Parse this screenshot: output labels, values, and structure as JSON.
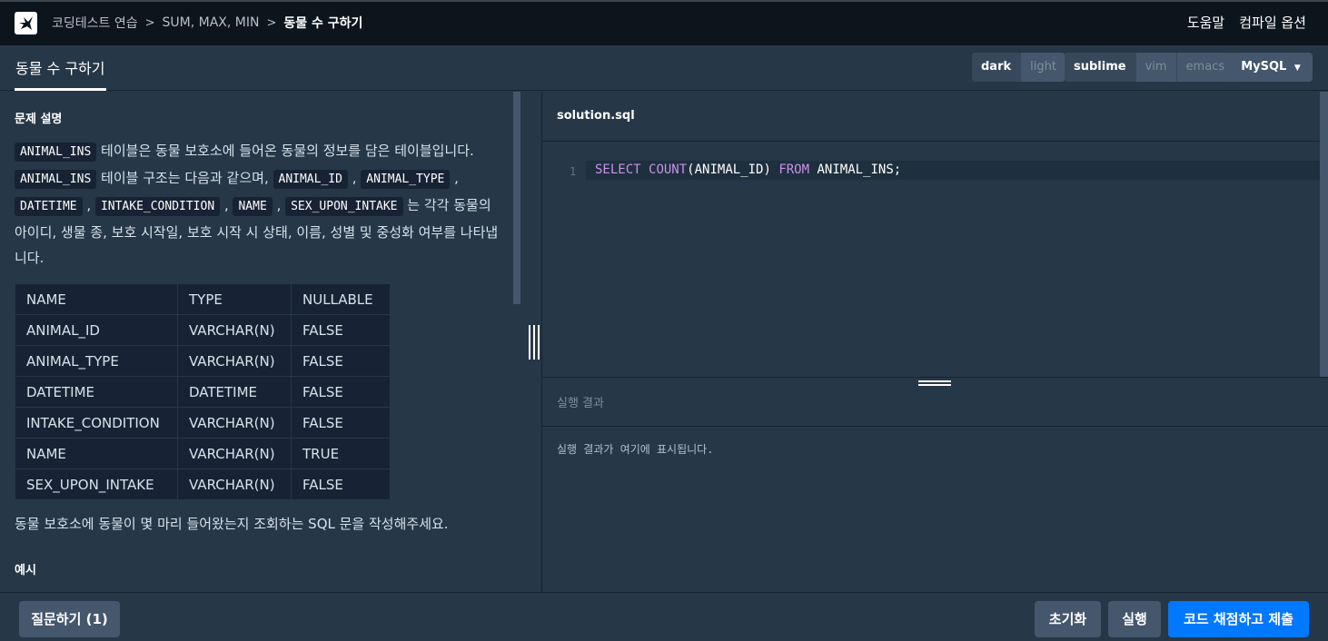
{
  "breadcrumb": {
    "items": [
      "코딩테스트 연습",
      "SUM, MAX, MIN"
    ],
    "current": "동물 수 구하기"
  },
  "top_links": {
    "help": "도움말",
    "compile_options": "컴파일 옵션"
  },
  "tab": {
    "title": "동물 수 구하기"
  },
  "theme_toggle": {
    "dark": "dark",
    "light": "light",
    "selected": "dark"
  },
  "keymap_toggle": {
    "sublime": "sublime",
    "vim": "vim",
    "emacs": "emacs",
    "selected": "sublime"
  },
  "language_select": {
    "value": "MySQL"
  },
  "problem": {
    "heading": "문제 설명",
    "codes": [
      "ANIMAL_INS",
      "ANIMAL_INS",
      "ANIMAL_ID",
      "ANIMAL_TYPE",
      "DATETIME",
      "INTAKE_CONDITION",
      "NAME",
      "SEX_UPON_INTAKE"
    ],
    "texts": [
      " 테이블은 동물 보호소에 들어온 동물의 정보를 담은 테이블입니다. ",
      " 테이블 구조는 다음과 같으며, ",
      " 는 각각 동물의 아이디, 생물 종, 보호 시작일, 보호 시작 시 상태, 이름, 성별 및 중성화 여부를 나타냅니다."
    ],
    "table": {
      "headers": [
        "NAME",
        "TYPE",
        "NULLABLE"
      ],
      "rows": [
        [
          "ANIMAL_ID",
          "VARCHAR(N)",
          "FALSE"
        ],
        [
          "ANIMAL_TYPE",
          "VARCHAR(N)",
          "FALSE"
        ],
        [
          "DATETIME",
          "DATETIME",
          "FALSE"
        ],
        [
          "INTAKE_CONDITION",
          "VARCHAR(N)",
          "FALSE"
        ],
        [
          "NAME",
          "VARCHAR(N)",
          "TRUE"
        ],
        [
          "SEX_UPON_INTAKE",
          "VARCHAR(N)",
          "FALSE"
        ]
      ]
    },
    "question": "동물 보호소에 동물이 몇 마리 들어왔는지 조회하는 SQL 문을 작성해주세요.",
    "example_heading": "예시"
  },
  "editor": {
    "filename": "solution.sql",
    "line_number": "1",
    "tokens": [
      {
        "t": "SELECT",
        "kw": true
      },
      {
        "t": " ",
        "kw": false
      },
      {
        "t": "COUNT",
        "kw": true
      },
      {
        "t": "(ANIMAL_ID) ",
        "kw": false
      },
      {
        "t": "FROM",
        "kw": true
      },
      {
        "t": " ANIMAL_INS;",
        "kw": false
      }
    ]
  },
  "result": {
    "heading": "실행 결과",
    "placeholder": "실행 결과가 여기에 표시됩니다."
  },
  "bottom": {
    "question_button": "질문하기 (1)",
    "reset_button": "초기화",
    "run_button": "실행",
    "submit_button": "코드 채점하고 제출"
  },
  "colors": {
    "accent": "#0078ff",
    "bg": "#263747",
    "panel": "#172334",
    "keyword": "#c792ea"
  }
}
